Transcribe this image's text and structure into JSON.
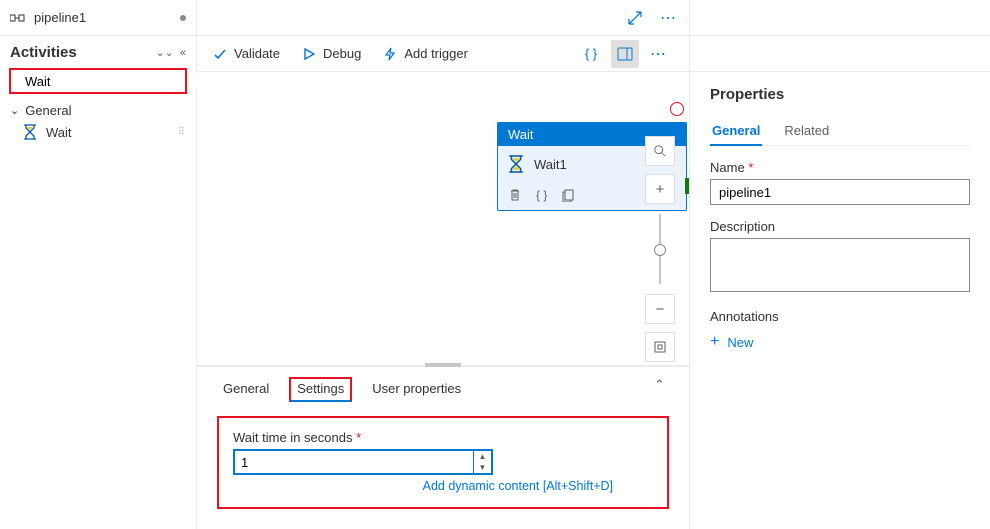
{
  "tab": {
    "title": "pipeline1"
  },
  "activities": {
    "heading": "Activities",
    "search_value": "Wait",
    "group_label": "General",
    "item_label": "Wait"
  },
  "toolbar": {
    "validate": "Validate",
    "debug": "Debug",
    "add_trigger": "Add trigger"
  },
  "node": {
    "type": "Wait",
    "name": "Wait1"
  },
  "bottom_tabs": {
    "general": "General",
    "settings": "Settings",
    "user_props": "User properties"
  },
  "settings": {
    "label": "Wait time in seconds",
    "value": "1",
    "dyn": "Add dynamic content [Alt+Shift+D]"
  },
  "props": {
    "heading": "Properties",
    "tab_general": "General",
    "tab_related": "Related",
    "name_label": "Name",
    "name_value": "pipeline1",
    "desc_label": "Description",
    "desc_value": "",
    "annotations_label": "Annotations",
    "new_label": "New"
  }
}
